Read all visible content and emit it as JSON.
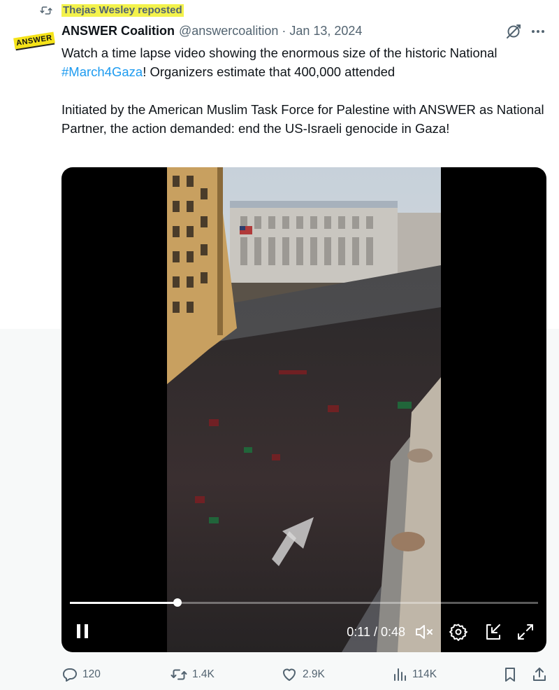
{
  "repost": {
    "text": "Thejas Wesley reposted"
  },
  "avatar": {
    "text": "ANSWER"
  },
  "author": {
    "name": "ANSWER Coalition",
    "handle": "@answercoalition",
    "separator": "·",
    "date": "Jan 13, 2024"
  },
  "tweet": {
    "line1_before": "Watch a time lapse video showing the enormous size of the historic National ",
    "hashtag": "#March4Gaza",
    "line1_after": "! Organizers estimate that 400,000 attended",
    "paragraph2": "Initiated by the American Muslim Task Force for Palestine with ANSWER as National Partner, the action demanded: end the US-Israeli genocide in Gaza!"
  },
  "video": {
    "time": "0:11 / 0:48",
    "progress": 0.23
  },
  "actions": {
    "replies": "120",
    "reposts": "1.4K",
    "likes": "2.9K",
    "views": "114K"
  },
  "icons": {
    "repost": "repost-icon",
    "grok": "grok-icon",
    "more": "more-icon",
    "pause": "pause-icon",
    "mute": "volume-muted-icon",
    "settings": "gear-icon",
    "pip": "picture-in-picture-icon",
    "fullscreen": "fullscreen-icon",
    "reply": "reply-icon",
    "views": "analytics-icon",
    "bookmark": "bookmark-icon",
    "share": "share-icon"
  },
  "colors": {
    "link": "#1d9bf0",
    "secondary_text": "#536471",
    "repost_highlight": "#f3f24c"
  }
}
